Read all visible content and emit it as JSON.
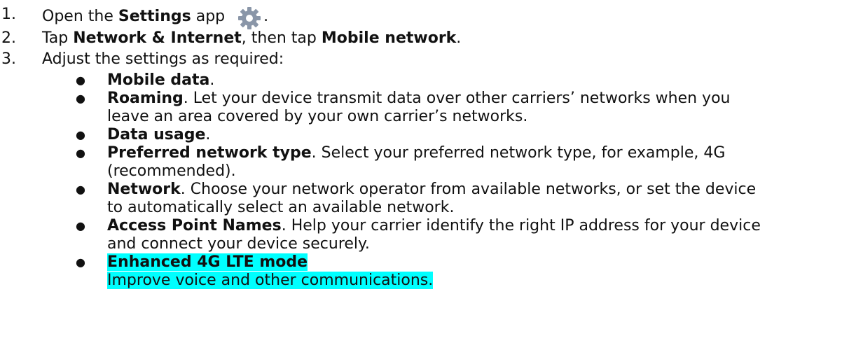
{
  "steps": [
    {
      "num": "1.",
      "text_before": "Open the ",
      "bold": "Settings",
      "text_after": " app",
      "icon": "gear-icon",
      "trailing": "."
    },
    {
      "num": "2.",
      "text_before": "Tap ",
      "bold1": "Network & Internet",
      "mid": ", then tap ",
      "bold2": "Mobile network",
      "trailing": "."
    },
    {
      "num": "3.",
      "text": "Adjust the settings as required:"
    }
  ],
  "bullets": [
    {
      "bold": "Mobile data",
      "line1": ".",
      "line2": ""
    },
    {
      "bold": "Roaming",
      "line1": ". Let your device transmit data over other carriers’ networks when you",
      "line2": "leave an area covered by your own carrier’s networks."
    },
    {
      "bold": "Data usage",
      "line1": ".",
      "line2": ""
    },
    {
      "bold": "Preferred network type",
      "line1": ". Select your preferred network type, for example, 4G",
      "line2": "(recommended)."
    },
    {
      "bold": "Network",
      "line1": ". Choose your network operator from available networks, or set the device",
      "line2": "to automatically select an available network."
    },
    {
      "bold": "Access Point Names",
      "line1": ". Help your carrier identify the right IP address for your device",
      "line2": "and connect your device securely."
    },
    {
      "bold": "Enhanced 4G LTE mode",
      "line1": "",
      "line2": "Improve voice and other communications.",
      "highlight": "#00ffff"
    }
  ],
  "bullet_glyph": "●"
}
